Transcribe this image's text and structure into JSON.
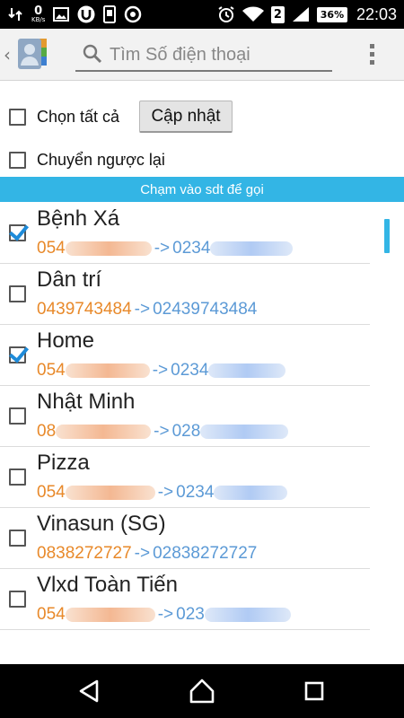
{
  "status_bar": {
    "speed_value": "0",
    "speed_unit": "KB/s",
    "sim_slot": "2",
    "battery": "36%",
    "time": "22:03",
    "icons": [
      "data-transfer-icon",
      "image-icon",
      "u-badge-icon",
      "phone-app-icon",
      "record-icon",
      "alarm-icon",
      "wifi-icon",
      "signal-icon",
      "battery-icon"
    ]
  },
  "action_bar": {
    "back_icon": "chevron-left-icon",
    "app_icon": "contacts-app-icon",
    "search_placeholder": "Tìm Số điện thoại",
    "menu_icon": "overflow-menu-icon"
  },
  "controls": {
    "select_all_label": "Chọn tất cả",
    "update_button": "Cập nhật",
    "reverse_label": "Chuyển ngược lại",
    "select_all_checked": false,
    "reverse_checked": false
  },
  "banner": {
    "text": "Chạm vào sdt để gọi",
    "color": "#33b5e5"
  },
  "contacts": [
    {
      "name": "Bệnh Xá",
      "original": "054",
      "arrow": "->",
      "converted": "0234",
      "checked": true,
      "masked": true
    },
    {
      "name": "Dân trí",
      "original": "0439743484",
      "arrow": "->",
      "converted": "02439743484",
      "checked": false,
      "masked": false
    },
    {
      "name": "Home",
      "original": "054",
      "arrow": "->",
      "converted": "0234",
      "checked": true,
      "masked": true
    },
    {
      "name": "Nhật Minh",
      "original": "08",
      "arrow": "->",
      "converted": "028",
      "checked": false,
      "masked": true
    },
    {
      "name": "Pizza",
      "original": "054",
      "arrow": "->",
      "converted": "0234",
      "checked": false,
      "masked": true
    },
    {
      "name": "Vinasun (SG)",
      "original": "0838272727",
      "arrow": "->",
      "converted": "02838272727",
      "checked": false,
      "masked": false
    },
    {
      "name": "Vlxd Toàn Tiến",
      "original": "054",
      "arrow": "->",
      "converted": "023",
      "checked": false,
      "masked": true
    }
  ],
  "colors": {
    "original_number": "#e8892a",
    "converted_number": "#5c9ad6",
    "checkmark": "#1e8bd9"
  },
  "navigation": {
    "back_icon": "nav-back-icon",
    "home_icon": "nav-home-icon",
    "recents_icon": "nav-recents-icon"
  }
}
